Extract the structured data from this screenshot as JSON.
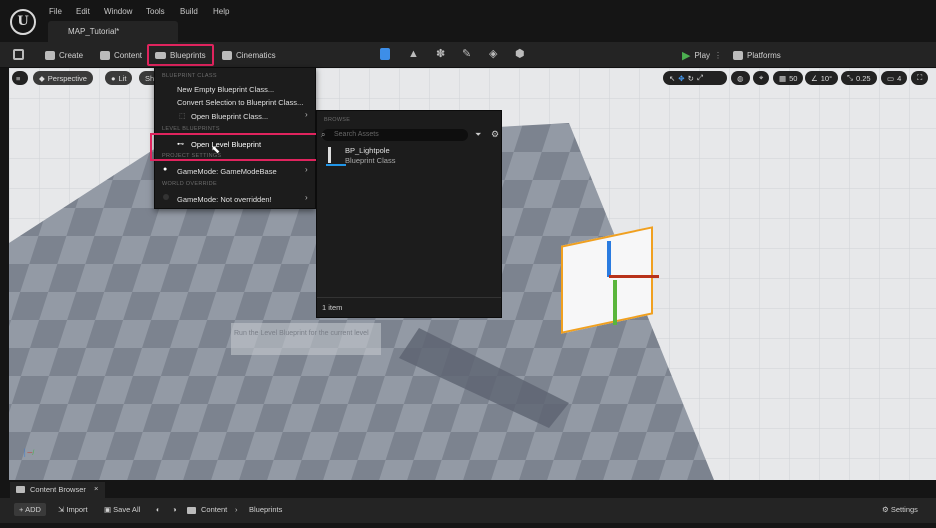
{
  "menubar": {
    "items": [
      "File",
      "Edit",
      "Window",
      "Tools",
      "Build",
      "Help"
    ],
    "tab": "MAP_Tutorial*"
  },
  "toolbar": {
    "create": "Create",
    "content": "Content",
    "blueprints": "Blueprints",
    "cinematics": "Cinematics",
    "play": "Play",
    "platforms": "Platforms"
  },
  "viewport": {
    "perspective": "Perspective",
    "lit": "Lit",
    "show": "Sh",
    "grid": "50",
    "angle": "10°",
    "scale": "0.25",
    "camera": "4",
    "tooltip": "Run the Level Blueprint for the current level"
  },
  "menu": {
    "header1": "BLUEPRINT CLASS",
    "new_empty": "New Empty Blueprint Class...",
    "convert": "Convert Selection to Blueprint Class...",
    "open_class": "Open Blueprint Class...",
    "header2": "LEVEL BLUEPRINTS",
    "open_level": "Open Level Blueprint",
    "header3": "PROJECT SETTINGS",
    "gamemode": "GameMode: GameModeBase",
    "header4": "WORLD OVERRIDE",
    "gamemode_override": "GameMode: Not overridden!"
  },
  "submenu": {
    "header": "BROWSE",
    "search_placeholder": "Search Assets",
    "asset_name": "BP_Lightpole",
    "asset_type": "Blueprint Class",
    "count": "1 item"
  },
  "content_browser": {
    "tab": "Content Browser",
    "add": "ADD",
    "import": "Import",
    "save_all": "Save All",
    "path": [
      "Content",
      "Blueprints"
    ],
    "settings": "Settings"
  },
  "colors": {
    "accent": "#e0245e",
    "highlight": "#2196e8",
    "play": "#4caf50"
  }
}
